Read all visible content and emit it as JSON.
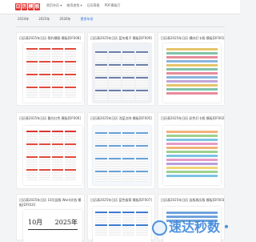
{
  "header": {
    "logo_text": [
      "日",
      "历",
      "模",
      "板"
    ],
    "nav": [
      "首页年历 ▾",
      "按用途找 ▾",
      "日历简报",
      "PDF模板打"
    ]
  },
  "year_tabs": [
    {
      "label": "2024年",
      "active": false
    },
    {
      "label": "2025年",
      "active": false
    },
    {
      "label": "2026年",
      "active": false
    },
    {
      "label": "更多年份",
      "active": true
    }
  ],
  "cards": [
    {
      "title": "日历表2025年日历 简约横版 模板[DF008]"
    },
    {
      "title": "日历表2025年日历 蓝灰格子 模板[DF009]"
    },
    {
      "title": "日历表2025年日历 横向打卡版 模板[DF001]"
    },
    {
      "title": "日历表2025年日历 暮光红色 模板[DF006]"
    },
    {
      "title": "日历表2025年日历 浅蓝点阵 模板[DF005]"
    },
    {
      "title": "日历表2025年日历 彩色打卡版 模板[DF002]"
    },
    {
      "title": "日历表2025年日历 10月竖版 Word文档 模板[DF010]"
    },
    {
      "title": "日历表2025年日历 蓝色极简 模板[DF007]"
    },
    {
      "title": "日历表2025年日历 竖版周历版 模板[DF003]"
    }
  ],
  "calendar_preview": {
    "month": "10月",
    "year": "2025年"
  },
  "watermark": {
    "text": "速达秒数・"
  },
  "colors": {
    "brand_red": "#e0312f",
    "accent_blue": "#2a6fdb",
    "watermark_blue": "#2e7fd9"
  }
}
